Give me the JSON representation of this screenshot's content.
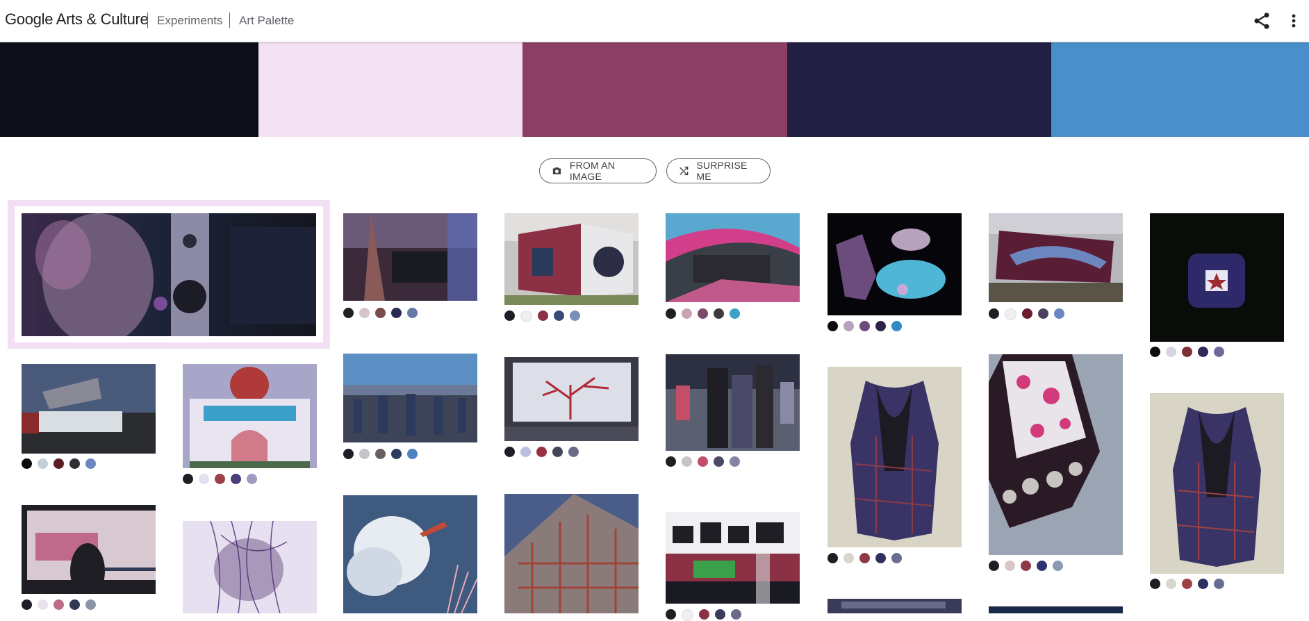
{
  "header": {
    "brand": "Google Arts & Culture",
    "crumbs": [
      "Experiments",
      "Art Palette"
    ],
    "icons": {
      "share": "share-icon",
      "more": "more-vert-icon"
    }
  },
  "palette": [
    "#0c0e18",
    "#f4e2f4",
    "#8b3f62",
    "#221f45",
    "#4a8fca"
  ],
  "buttons": {
    "from_image": "FROM AN IMAGE",
    "surprise": "SURPRISE ME"
  },
  "grid": [
    {
      "id": "man-studio",
      "dots": []
    },
    {
      "id": "piano-church",
      "dots": [
        "#202124",
        "#d6c5c6",
        "#7a4a4d",
        "#2c2a55",
        "#6379a8"
      ]
    },
    {
      "id": "mural-cube",
      "dots": [
        "#1e1e24",
        "#efeff0",
        "#8b3045",
        "#3a4a78",
        "#7b8fb8"
      ]
    },
    {
      "id": "street-art-plaza",
      "dots": [
        "#1e1e24",
        "#c9a5b3",
        "#7c4a6b",
        "#3b3b40",
        "#3ea0c9"
      ]
    },
    {
      "id": "minerals",
      "dots": [
        "#0c0c10",
        "#b7a1bd",
        "#6b4c7d",
        "#2c2448",
        "#2f8bc4"
      ]
    },
    {
      "id": "painted-block",
      "dots": [
        "#1e1e24",
        "#efeff2",
        "#6b1e30",
        "#4a4460",
        "#6c86bf"
      ]
    },
    {
      "id": "square-tile",
      "dots": [
        "#0c0c10",
        "#d9d5e0",
        "#7b3038",
        "#2e2a5a",
        "#6b6a9a"
      ]
    },
    {
      "id": "billboard-dusk",
      "dots": [
        "#0c0c10",
        "#c5d0d6",
        "#5b1e24",
        "#2c2f34",
        "#6c88c2"
      ]
    },
    {
      "id": "palace-building",
      "dots": [
        "#1e1e24",
        "#e4e0ef",
        "#9c4246",
        "#4a3e7a",
        "#9d9bc3"
      ]
    },
    {
      "id": "crowd-hall",
      "dots": [
        "#1e1e24",
        "#c1c4c8",
        "#6a5e60",
        "#2e3a5c",
        "#4d82c0"
      ]
    },
    {
      "id": "coral-painting",
      "dots": [
        "#1e1e24",
        "#bcbde0",
        "#983040",
        "#434359",
        "#6a6a8a"
      ]
    },
    {
      "id": "people-street",
      "dots": [
        "#1e1e24",
        "#c6c6c6",
        "#c24e68",
        "#4a4a68",
        "#8383a8"
      ]
    },
    {
      "id": "vest-1",
      "dots": [
        "#1e1e24",
        "#d8d6cc",
        "#8c3a48",
        "#2f3060",
        "#676e92"
      ]
    },
    {
      "id": "embroidered-sleeve",
      "dots": [
        "#1e1e24",
        "#dac6c8",
        "#8c3a48",
        "#2f3470",
        "#8a9ab0"
      ]
    },
    {
      "id": "vest-2",
      "dots": [
        "#1e1e24",
        "#d8d6cc",
        "#9c4246",
        "#2e3060",
        "#676e92"
      ]
    },
    {
      "id": "screen-viewer",
      "dots": [
        "#1e1e24",
        "#e8e2ef",
        "#c06a8a",
        "#2e3a54",
        "#8b94a8"
      ]
    },
    {
      "id": "purple-threads",
      "dots": []
    },
    {
      "id": "sky-painting",
      "dots": []
    },
    {
      "id": "steel-frame",
      "dots": []
    },
    {
      "id": "graffiti-wall",
      "dots": [
        "#1e1e24",
        "#efeff0",
        "#8b3045",
        "#3a3a5a",
        "#6a6a8a"
      ]
    },
    {
      "id": "partial-1",
      "dots": []
    },
    {
      "id": "partial-2",
      "dots": []
    }
  ]
}
